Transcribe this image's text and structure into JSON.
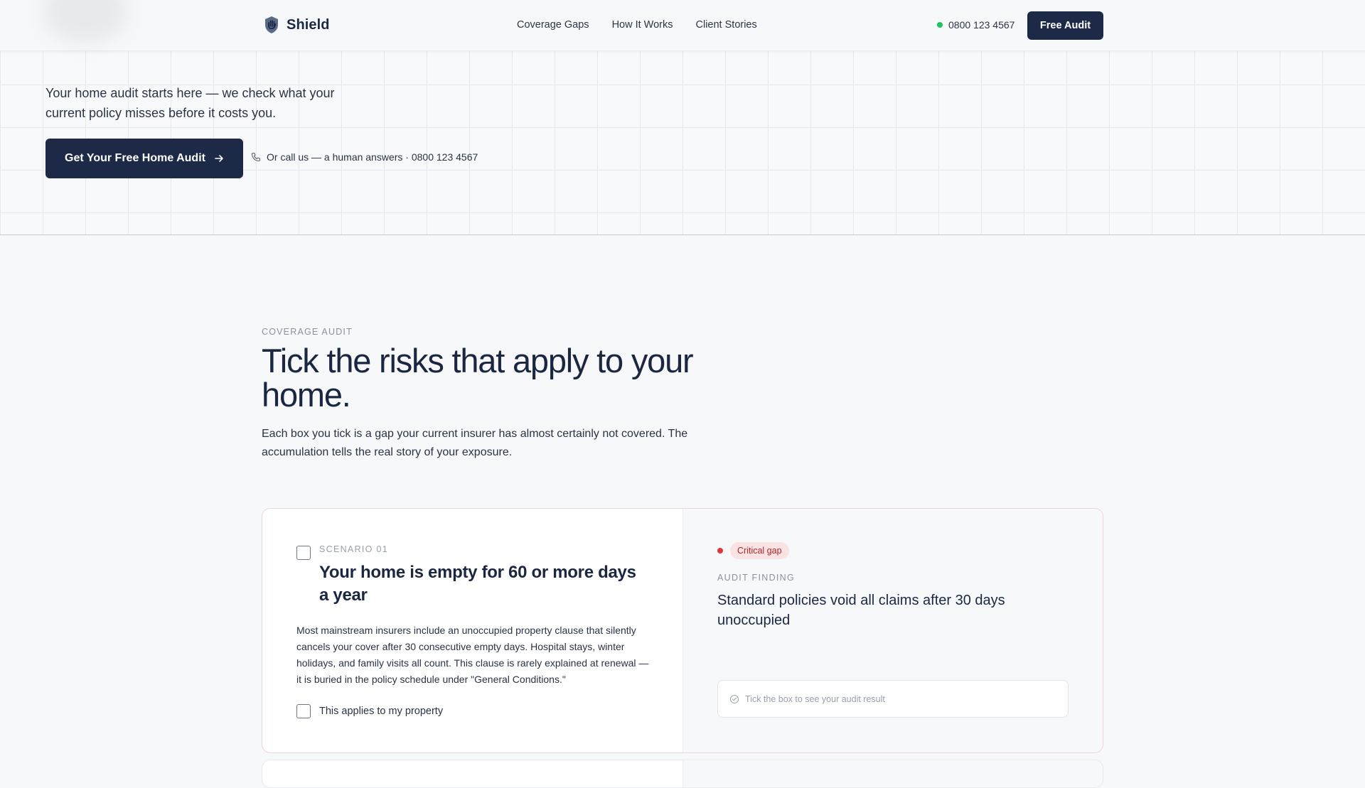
{
  "header": {
    "brand_name": "Shield",
    "nav": [
      "Coverage Gaps",
      "How It Works",
      "Client Stories"
    ],
    "phone": "0800 123 4567",
    "cta_label": "Free Audit"
  },
  "hero": {
    "text": "Your home audit starts here — we check what your current policy misses before it costs you.",
    "cta_label": "Get Your Free Home Audit",
    "call_text": "Or call us — a human answers · 0800 123 4567"
  },
  "section": {
    "eyebrow": "COVERAGE AUDIT",
    "title": "Tick the risks that apply to your home.",
    "description": "Each box you tick is a gap your current insurer has almost certainly not covered. The accumulation tells the real story of your exposure."
  },
  "scenario": {
    "label": "SCENARIO 01",
    "title": "Your home is empty for 60 or more days a year",
    "body": "Most mainstream insurers include an unoccupied property clause that silently cancels your cover after 30 consecutive empty days. Hospital stays, winter holidays, and family visits all count. This clause is rarely explained at renewal — it is buried in the policy schedule under \"General Conditions.\"",
    "applies_label": "This applies to my property",
    "checked": false,
    "badge": "Critical gap",
    "finding_label": "AUDIT FINDING",
    "finding_text": "Standard policies void all claims after 30 days unoccupied",
    "result_placeholder": "Tick the box to see your audit result"
  },
  "colors": {
    "navy": "#1c2947",
    "critical_red": "#e0353b",
    "status_green": "#22c25e"
  }
}
